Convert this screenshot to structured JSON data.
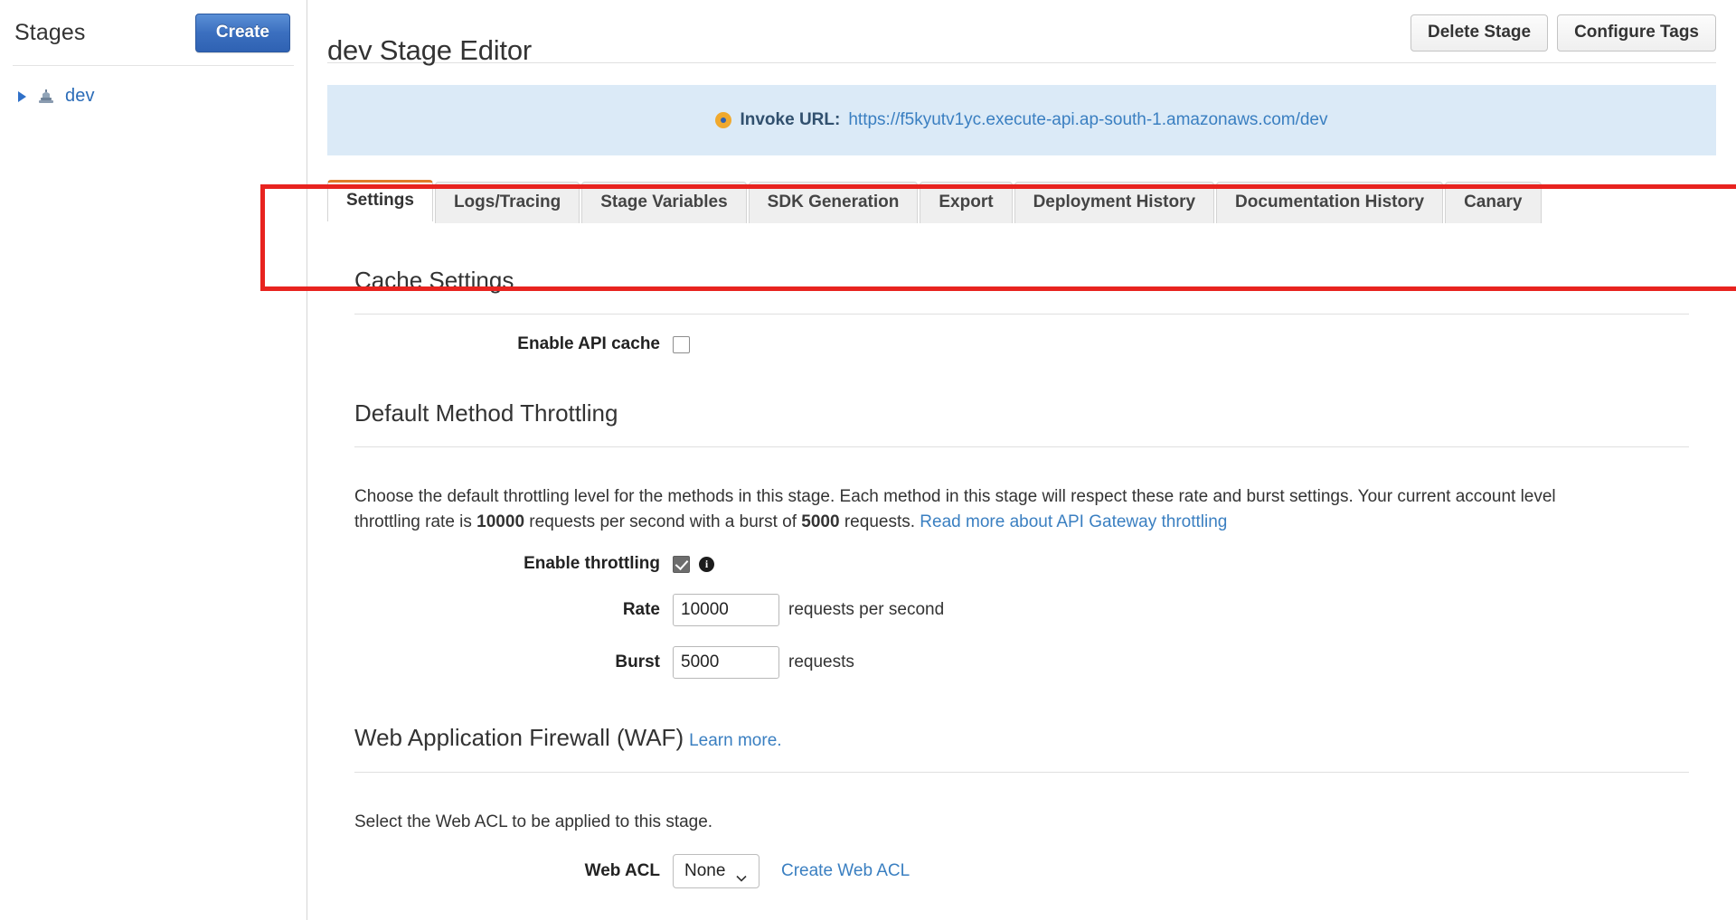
{
  "sidebar": {
    "title": "Stages",
    "create_label": "Create",
    "tree": [
      {
        "label": "dev",
        "icon": "stage-icon",
        "caret": "collapsed"
      }
    ]
  },
  "header": {
    "title": "dev Stage Editor",
    "actions": [
      {
        "label": "Delete Stage",
        "name": "delete-stage-button"
      },
      {
        "label": "Configure Tags",
        "name": "configure-tags-button"
      }
    ]
  },
  "invoke": {
    "label": "Invoke URL:",
    "url": "https://f5kyutv1yc.execute-api.ap-south-1.amazonaws.com/dev",
    "icon": "orange-dot-icon"
  },
  "tabs": [
    {
      "label": "Settings",
      "active": true
    },
    {
      "label": "Logs/Tracing",
      "active": false
    },
    {
      "label": "Stage Variables",
      "active": false
    },
    {
      "label": "SDK Generation",
      "active": false
    },
    {
      "label": "Export",
      "active": false
    },
    {
      "label": "Deployment History",
      "active": false
    },
    {
      "label": "Documentation History",
      "active": false
    },
    {
      "label": "Canary",
      "active": false
    }
  ],
  "cache": {
    "heading": "Cache Settings",
    "enable_label": "Enable API cache",
    "enable_checked": false
  },
  "throttling": {
    "heading": "Default Method Throttling",
    "description_part1": "Choose the default throttling level for the methods in this stage. Each method in this stage will respect these rate and burst settings. Your current account level throttling rate is ",
    "account_rate": "10000",
    "description_part2": " requests per second with a burst of ",
    "account_burst": "5000",
    "description_part3": " requests. ",
    "read_more_link": "Read more about API Gateway throttling",
    "enable_label": "Enable throttling",
    "enable_checked": true,
    "info_icon": "info-icon",
    "rate_label": "Rate",
    "rate_value": "10000",
    "rate_unit": "requests per second",
    "burst_label": "Burst",
    "burst_value": "5000",
    "burst_unit": "requests"
  },
  "waf": {
    "heading": "Web Application Firewall (WAF)",
    "learn_more": "Learn more.",
    "description": "Select the Web ACL to be applied to this stage.",
    "acl_label": "Web ACL",
    "acl_value": "None",
    "acl_options": [
      "None"
    ],
    "create_link": "Create Web ACL"
  },
  "colors": {
    "accent_orange": "#e07b2b",
    "link_blue": "#3a7fc1",
    "banner_blue": "#dbeaf7",
    "primary_button": "#2f62b3",
    "annotation_red": "#e8231f"
  }
}
